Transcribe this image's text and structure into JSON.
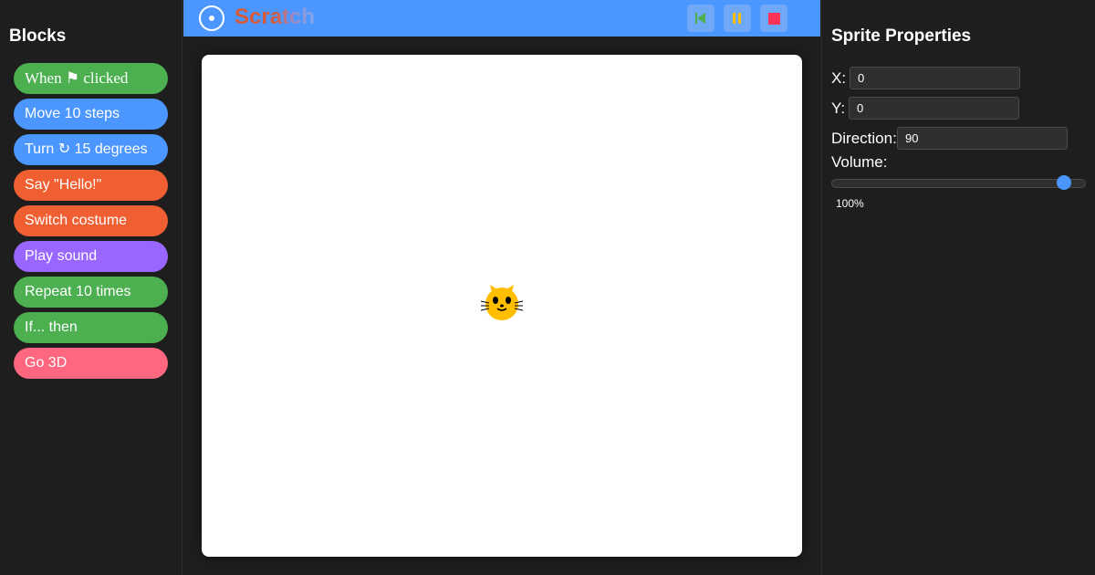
{
  "blocks_panel": {
    "title": "Blocks",
    "items": [
      {
        "label": "When ⚑ clicked",
        "color": "#4caf50",
        "font": "serif"
      },
      {
        "label": "Move 10 steps",
        "color": "#4c97ff"
      },
      {
        "label": "Turn ↻ 15 degrees",
        "color": "#4c97ff"
      },
      {
        "label": "Say \"Hello!\"",
        "color": "#f05f32"
      },
      {
        "label": "Switch costume",
        "color": "#f05f32"
      },
      {
        "label": "Play sound",
        "color": "#9966ff"
      },
      {
        "label": "Repeat 10 times",
        "color": "#4caf50"
      },
      {
        "label": "If... then",
        "color": "#4caf50"
      },
      {
        "label": "Go 3D",
        "color": "#ff6680"
      }
    ]
  },
  "topbar": {
    "logo_text": "Scratch",
    "color": "#4c97ff",
    "controls": [
      {
        "icon": "rewind-icon",
        "color": "#4caf50"
      },
      {
        "icon": "pause-icon",
        "color": "#ffbf00"
      },
      {
        "icon": "stop-icon",
        "color": "#ff3355"
      }
    ]
  },
  "stage": {
    "sprite_icon": "cat-sprite-icon",
    "sprite_color": "#ffbf00"
  },
  "properties": {
    "title": "Sprite Properties",
    "x_label": "X:",
    "x_value": "0",
    "y_label": "Y:",
    "y_value": "0",
    "direction_label": "Direction:",
    "direction_value": "90",
    "volume_label": "Volume:",
    "volume_fraction": 0.94,
    "volume_text": "100%"
  }
}
